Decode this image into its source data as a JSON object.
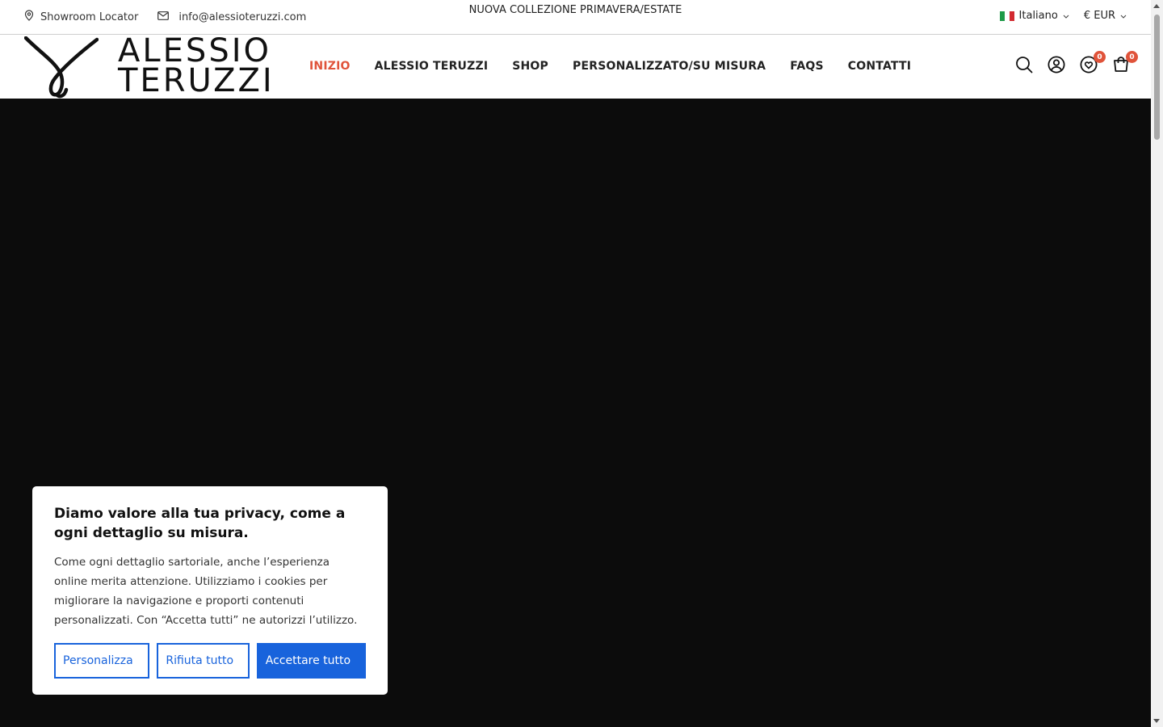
{
  "topbar": {
    "showroom_label": "Showroom Locator",
    "email": "info@alessioteruzzi.com",
    "announcement": "NUOVA COLLEZIONE PRIMAVERA/ESTATE",
    "language": "Italiano",
    "currency": "€ EUR"
  },
  "logo": {
    "line1": "ALESSIO",
    "line2": "TERUZZI"
  },
  "nav": {
    "items": [
      "INIZIO",
      "ALESSIO TERUZZI",
      "SHOP",
      "PERSONALIZZATO/SU MISURA",
      "FAQS",
      "CONTATTI"
    ],
    "active_color": "#e0533a"
  },
  "header_icons": {
    "wishlist_count": "0",
    "cart_count": "0",
    "badge_color": "#e0533a"
  },
  "cookie": {
    "title": "Diamo valore alla tua privacy, come a ogni dettaglio su misura.",
    "body": "Come ogni dettaglio sartoriale, anche l’esperienza online merita attenzione. Utilizziamo i cookies per migliorare la navigazione e proporti contenuti personalizzati. Con “Accetta tutti” ne autorizzi l’utilizzo.",
    "customize_label": "Personalizza",
    "reject_label": "Rifiuta tutto",
    "accept_label": "Accettare tutto",
    "accent_color": "#1863dc"
  },
  "hero": {
    "background_color": "#0c0c0c"
  }
}
